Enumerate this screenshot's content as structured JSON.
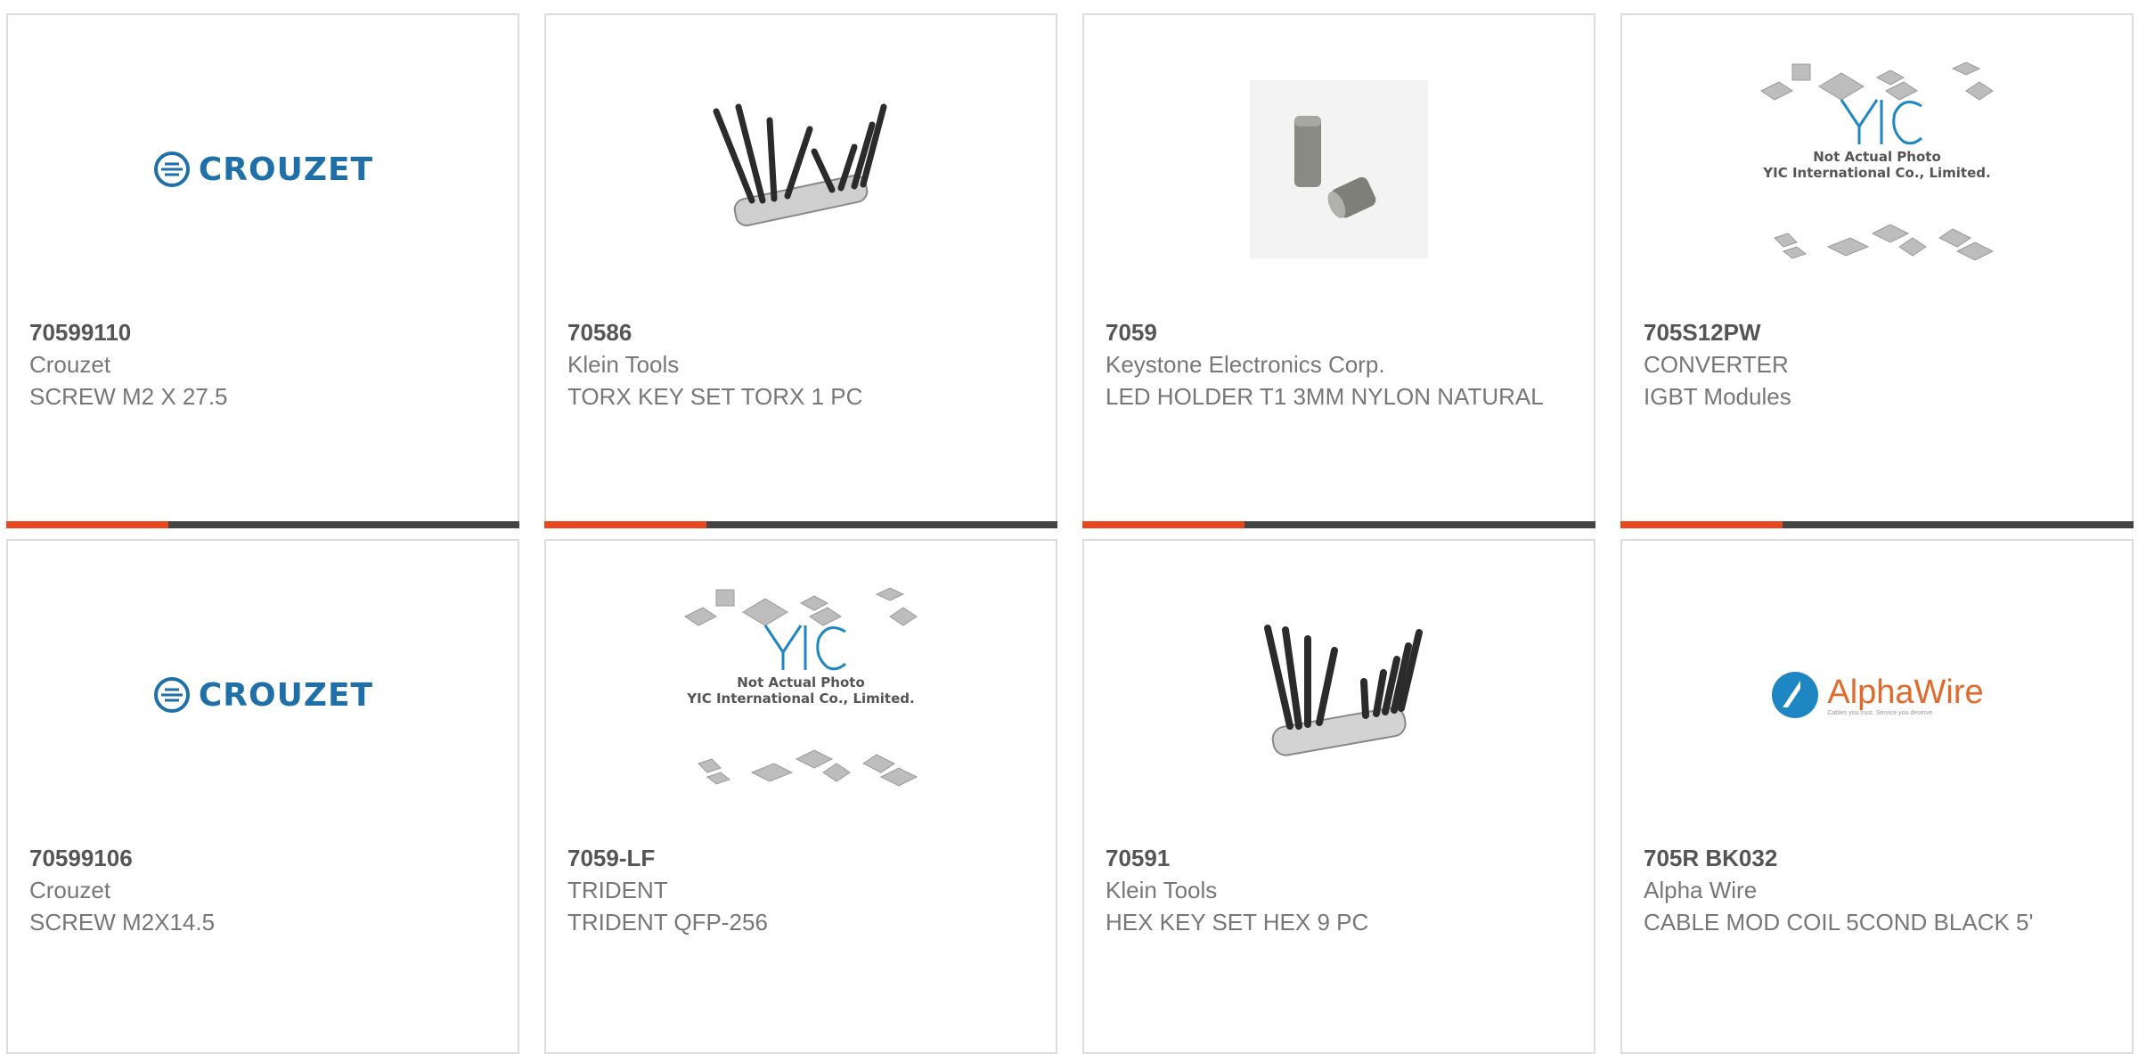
{
  "products": [
    {
      "part_number": "70599110",
      "manufacturer": "Crouzet",
      "description": "SCREW M2 X 27.5",
      "image": "crouzet-logo"
    },
    {
      "part_number": "70586",
      "manufacturer": "Klein Tools",
      "description": "TORX KEY SET TORX 1 PC",
      "image": "torx-key-set"
    },
    {
      "part_number": "7059",
      "manufacturer": "Keystone Electronics Corp.",
      "description": "LED HOLDER T1 3MM NYLON NATURAL",
      "image": "led-holder"
    },
    {
      "part_number": "705S12PW",
      "manufacturer": "CONVERTER",
      "description": "IGBT Modules",
      "image": "yic-placeholder"
    },
    {
      "part_number": "70599106",
      "manufacturer": "Crouzet",
      "description": "SCREW M2X14.5",
      "image": "crouzet-logo"
    },
    {
      "part_number": "7059-LF",
      "manufacturer": "TRIDENT",
      "description": "TRIDENT QFP-256",
      "image": "yic-placeholder"
    },
    {
      "part_number": "70591",
      "manufacturer": "Klein Tools",
      "description": "HEX KEY SET HEX 9 PC",
      "image": "hex-key-set"
    },
    {
      "part_number": "705R BK032",
      "manufacturer": "Alpha Wire",
      "description": "CABLE MOD COIL 5COND BLACK 5'",
      "image": "alphawire-logo"
    }
  ],
  "logos": {
    "crouzet": "CROUZET",
    "alphawire": "AlphaWire",
    "alphawire_tagline": "Cables you trust. Service you deserve.",
    "yic_line1": "Not Actual Photo",
    "yic_line2": "YIC International Co., Limited."
  },
  "colors": {
    "accent": "#e8461c",
    "bar": "#444444",
    "border": "#dcdcdc",
    "crouzet_blue": "#1f6fa8",
    "alphawire_orange": "#e36a2b"
  }
}
